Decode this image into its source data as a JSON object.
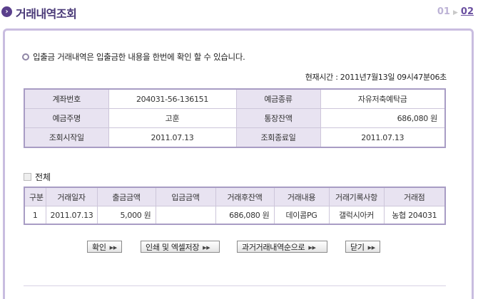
{
  "header": {
    "title": "거래내역조회",
    "step1": "01",
    "step2": "02",
    "icon": "chevron-right-icon"
  },
  "info": "입출금 거래내역은 입출금한 내용을 한번에 확인 할 수 있습니다.",
  "now": "현재시간 : 2011년7월13일 09시47분06초",
  "account": {
    "account_no_label": "계좌번호",
    "account_no": "204031-56-136151",
    "type_label": "예금종류",
    "type": "자유저축예탁금",
    "owner_label": "예금주명",
    "owner": "고훈",
    "balance_label": "통장잔액",
    "balance": "686,080 원",
    "start_label": "조회시작일",
    "start": "2011.07.13",
    "end_label": "조회종료일",
    "end": "2011.07.13"
  },
  "filter_label": "전체",
  "tx": {
    "headers": [
      "구분",
      "거래일자",
      "출금금액",
      "입금금액",
      "거래후잔액",
      "거래내용",
      "거래기록사항",
      "거래점"
    ],
    "rows": [
      [
        "1",
        "2011.07.13",
        "5,000 원",
        "",
        "686,080 원",
        "데이콤PG",
        "갤럭시아커",
        "농협 204031"
      ]
    ]
  },
  "buttons": {
    "confirm": "확인",
    "print": "인쇄 및 엑셀저장",
    "past": "과거거래내역순으로",
    "close": "닫기"
  },
  "colors": {
    "accent": "#5a3f8c",
    "border": "#c9bde0",
    "label_bg": "#e8e3f1"
  }
}
